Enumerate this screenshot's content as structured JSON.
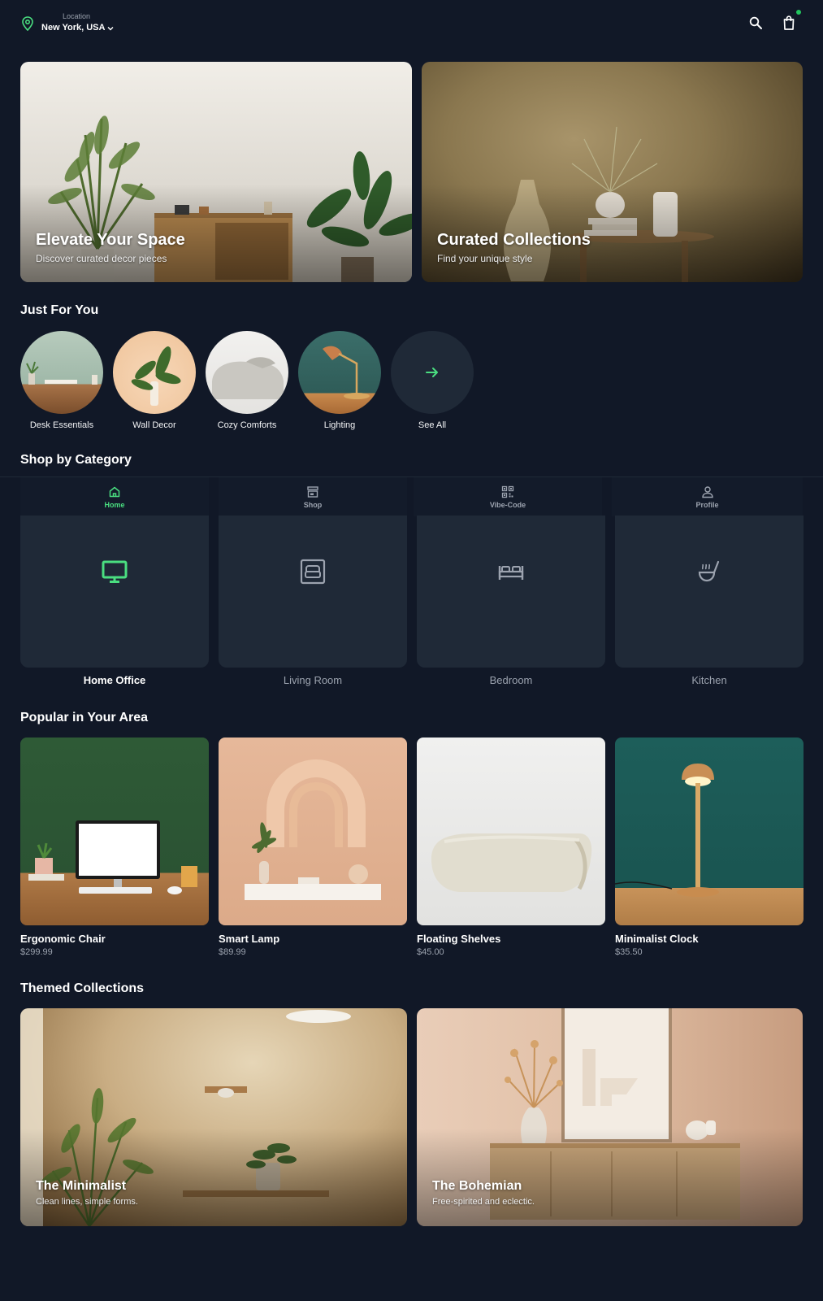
{
  "header": {
    "location_label": "Location",
    "location_value": "New York, USA",
    "icons": [
      "map-pin-icon",
      "chevron-down-icon",
      "search-icon",
      "shopping-bag-icon"
    ],
    "cart_indicator_color": "#22c55e"
  },
  "hero": [
    {
      "title": "Elevate Your Space",
      "subtitle": "Discover curated decor pieces"
    },
    {
      "title": "Curated Collections",
      "subtitle": "Find your unique style"
    }
  ],
  "just_for_you": {
    "title": "Just For You",
    "items": [
      {
        "label": "Desk Essentials"
      },
      {
        "label": "Wall Decor"
      },
      {
        "label": "Cozy Comforts"
      },
      {
        "label": "Lighting"
      },
      {
        "label": "See All",
        "icon": "arrow-right-icon"
      }
    ]
  },
  "shop_by_category": {
    "title": "Shop by Category",
    "tabs": [
      {
        "label": "Home",
        "icon": "home-icon",
        "active": true
      },
      {
        "label": "Shop",
        "icon": "store-icon",
        "active": false
      },
      {
        "label": "Vibe-Code",
        "icon": "qr-code-icon",
        "active": false
      },
      {
        "label": "Profile",
        "icon": "user-icon",
        "active": false
      }
    ],
    "categories": [
      {
        "label": "Home Office",
        "icon": "monitor-icon",
        "active": true
      },
      {
        "label": "Living Room",
        "icon": "sofa-icon",
        "active": false
      },
      {
        "label": "Bedroom",
        "icon": "bed-icon",
        "active": false
      },
      {
        "label": "Kitchen",
        "icon": "soup-ladle-icon",
        "active": false
      }
    ]
  },
  "popular": {
    "title": "Popular in Your Area",
    "products": [
      {
        "name": "Ergonomic Chair",
        "price": "$299.99"
      },
      {
        "name": "Smart Lamp",
        "price": "$89.99"
      },
      {
        "name": "Floating Shelves",
        "price": "$45.00"
      },
      {
        "name": "Minimalist Clock",
        "price": "$35.50"
      }
    ]
  },
  "themed": {
    "title": "Themed Collections",
    "collections": [
      {
        "title": "The Minimalist",
        "subtitle": "Clean lines, simple forms."
      },
      {
        "title": "The Bohemian",
        "subtitle": "Free-spirited and eclectic."
      }
    ]
  },
  "colors": {
    "background": "#111827",
    "surface": "#1f2937",
    "accent": "#4ade80",
    "muted_text": "#9ca3af"
  }
}
